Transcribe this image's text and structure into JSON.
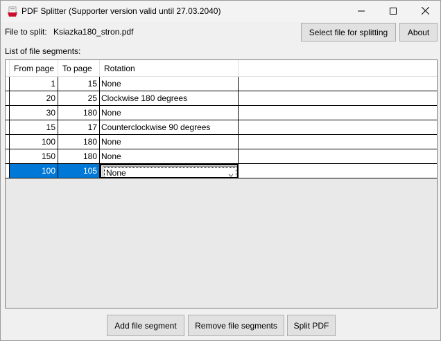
{
  "window": {
    "title": "PDF Splitter (Supporter version valid until 27.03.2040)",
    "icons": {
      "app": "pdf-splitter-app-icon",
      "minimize": "minimize-icon",
      "maximize": "maximize-icon",
      "close": "close-icon"
    }
  },
  "file": {
    "label": "File to split:",
    "name": "Ksiazka180_stron.pdf"
  },
  "toolbar": {
    "select_file_label": "Select file for splitting",
    "about_label": "About"
  },
  "segments": {
    "label": "List of file segments:",
    "columns": [
      "From page",
      "To page",
      "Rotation"
    ],
    "rows": [
      {
        "from": "1",
        "to": "15",
        "rotation": "None"
      },
      {
        "from": "20",
        "to": "25",
        "rotation": "Clockwise 180 degrees"
      },
      {
        "from": "30",
        "to": "180",
        "rotation": "None"
      },
      {
        "from": "15",
        "to": "17",
        "rotation": "Counterclockwise 90 degrees"
      },
      {
        "from": "100",
        "to": "180",
        "rotation": "None"
      },
      {
        "from": "150",
        "to": "180",
        "rotation": "None"
      },
      {
        "from": "100",
        "to": "105",
        "rotation": "None",
        "selected": true,
        "editing": true
      }
    ]
  },
  "actions": {
    "add_label": "Add file segment",
    "remove_label": "Remove file segments",
    "split_label": "Split PDF"
  },
  "colors": {
    "selection": "#0078d7",
    "button_face": "#e1e1e1",
    "grid_background": "#e9e9e9"
  }
}
